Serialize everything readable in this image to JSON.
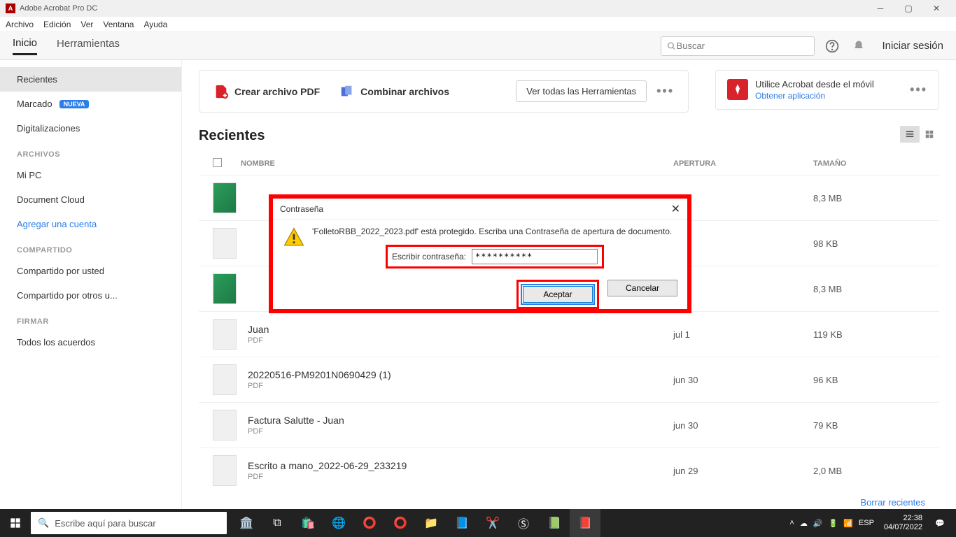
{
  "titlebar": {
    "app_name": "Adobe Acrobat Pro DC"
  },
  "menubar": [
    "Archivo",
    "Edición",
    "Ver",
    "Ventana",
    "Ayuda"
  ],
  "tabs": {
    "home": "Inicio",
    "tools": "Herramientas"
  },
  "search_placeholder": "Buscar",
  "signin": "Iniciar sesión",
  "toolbar": {
    "create_pdf": "Crear archivo PDF",
    "combine": "Combinar archivos",
    "see_all": "Ver todas las Herramientas"
  },
  "promo": {
    "title": "Utilice Acrobat desde el móvil",
    "link": "Obtener aplicación"
  },
  "sidebar": {
    "recent": "Recientes",
    "marked": "Marcado",
    "marked_badge": "NUEVA",
    "scans": "Digitalizaciones",
    "hdr_files": "ARCHIVOS",
    "mypc": "Mi PC",
    "doccloud": "Document Cloud",
    "addacct": "Agregar una cuenta",
    "hdr_shared": "COMPARTIDO",
    "shared_by_you": "Compartido por usted",
    "shared_by_others": "Compartido por otros u...",
    "hdr_sign": "FIRMAR",
    "agreements": "Todos los acuerdos"
  },
  "section_title": "Recientes",
  "columns": {
    "name": "NOMBRE",
    "opened": "APERTURA",
    "size": "TAMAÑO"
  },
  "files": [
    {
      "name": "",
      "type": "",
      "opened": "",
      "size": "8,3 MB",
      "thumb": "green"
    },
    {
      "name": "",
      "type": "",
      "opened": "",
      "size": "98 KB",
      "thumb": "doc"
    },
    {
      "name": "",
      "type": "",
      "opened": "",
      "size": "8,3 MB",
      "thumb": "green"
    },
    {
      "name": "Juan",
      "type": "PDF",
      "opened": "jul 1",
      "size": "119 KB",
      "thumb": "doc"
    },
    {
      "name": "20220516-PM9201N0690429 (1)",
      "type": "PDF",
      "opened": "jun 30",
      "size": "96 KB",
      "thumb": "doc"
    },
    {
      "name": "Factura Salutte - Juan",
      "type": "PDF",
      "opened": "jun 30",
      "size": "79 KB",
      "thumb": "doc"
    },
    {
      "name": "Escrito a mano_2022-06-29_233219",
      "type": "PDF",
      "opened": "jun 29",
      "size": "2,0 MB",
      "thumb": "blank"
    }
  ],
  "clear_recents": "Borrar recientes",
  "dialog": {
    "title": "Contraseña",
    "message": "'FolletoRBB_2022_2023.pdf' está protegido. Escriba una Contraseña de apertura de documento.",
    "label": "Escribir contraseña:",
    "value": "**********",
    "accept": "Aceptar",
    "cancel": "Cancelar"
  },
  "taskbar": {
    "search_placeholder": "Escribe aquí para buscar",
    "lang": "ESP",
    "time": "22:38",
    "date": "04/07/2022"
  }
}
